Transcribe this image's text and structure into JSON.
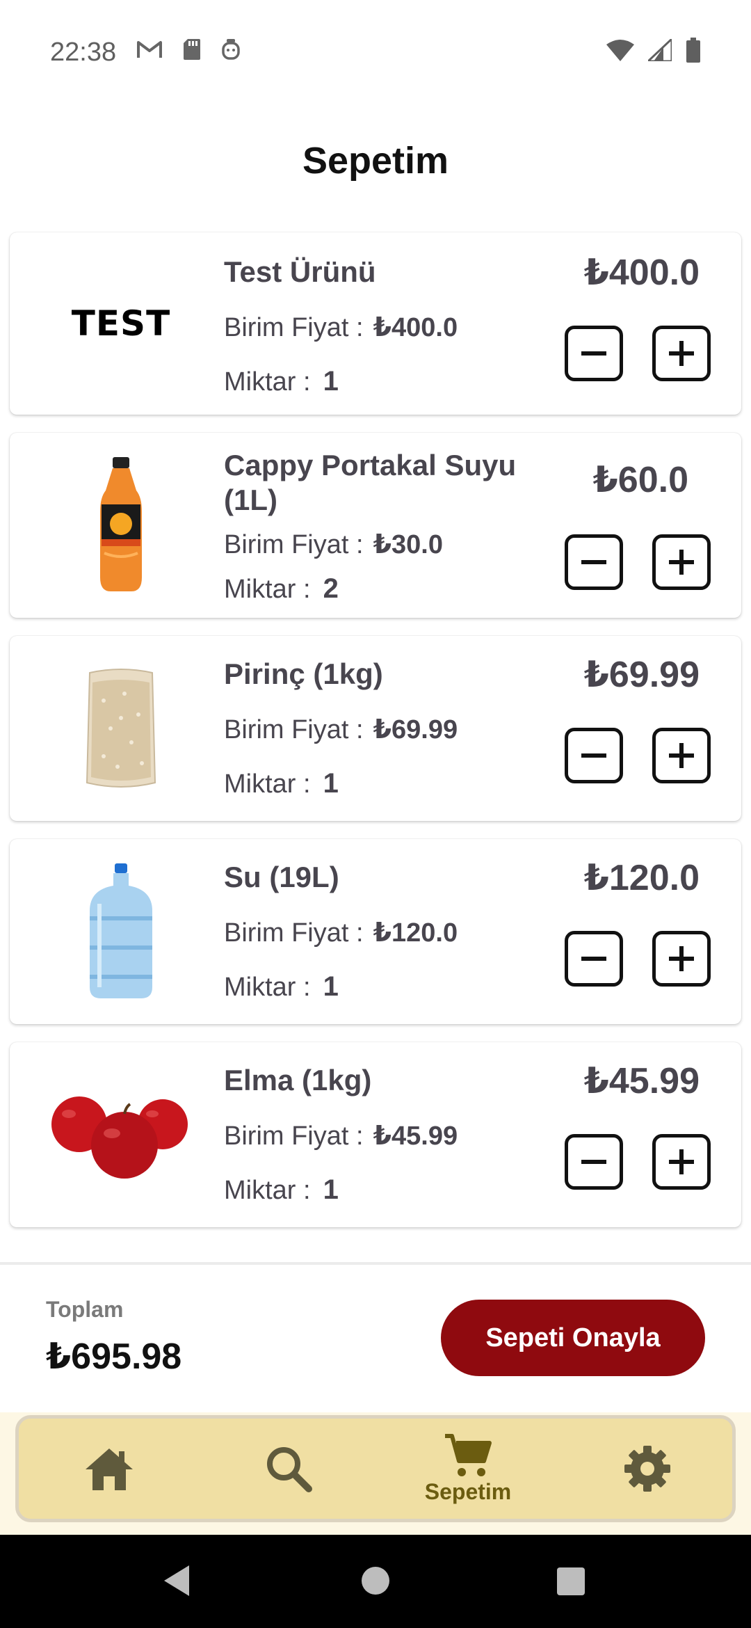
{
  "status_bar": {
    "time": "22:38",
    "left_icons": [
      "gmail-icon",
      "sd-card-icon",
      "assistant-icon"
    ],
    "right_icons": [
      "wifi-icon",
      "signal-icon",
      "battery-icon"
    ]
  },
  "header": {
    "title": "Sepetim"
  },
  "cart": {
    "unit_price_label": "Birim Fiyat :",
    "quantity_label": "Miktar :",
    "items": [
      {
        "name": "Test Ürünü",
        "image": "test-logo",
        "image_text": "TEST",
        "unit_price": "₺400.0",
        "quantity": "1",
        "total": "₺400.0"
      },
      {
        "name": "Cappy Portakal Suyu (1L)",
        "image": "orange-juice-bottle",
        "unit_price": "₺30.0",
        "quantity": "2",
        "total": "₺60.0"
      },
      {
        "name": "Pirinç (1kg)",
        "image": "rice-bag",
        "unit_price": "₺69.99",
        "quantity": "1",
        "total": "₺69.99"
      },
      {
        "name": "Su (19L)",
        "image": "water-jug",
        "unit_price": "₺120.0",
        "quantity": "1",
        "total": "₺120.0"
      },
      {
        "name": "Elma (1kg)",
        "image": "apples",
        "unit_price": "₺45.99",
        "quantity": "1",
        "total": "₺45.99"
      }
    ]
  },
  "summary": {
    "total_label": "Toplam",
    "total_value": "₺695.98",
    "confirm_label": "Sepeti Onayla"
  },
  "bottom_nav": {
    "items": [
      {
        "icon": "home-icon",
        "label": ""
      },
      {
        "icon": "search-icon",
        "label": ""
      },
      {
        "icon": "cart-icon",
        "label": "Sepetim",
        "active": true
      },
      {
        "icon": "gear-icon",
        "label": ""
      }
    ]
  },
  "colors": {
    "accent": "#8f0a0f",
    "nav_background": "#f0dfa3",
    "nav_icon": "#5f5a3c",
    "nav_active": "#6b5c10",
    "text": "#48454e"
  }
}
